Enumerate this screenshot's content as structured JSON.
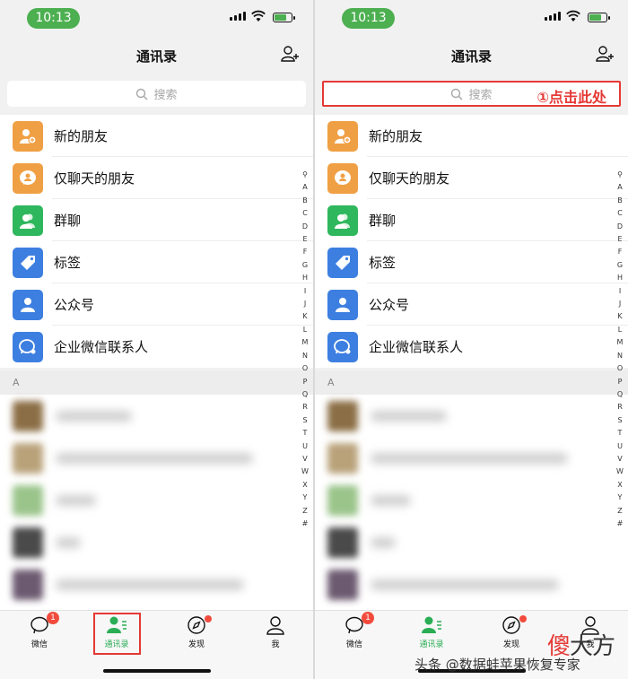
{
  "status_bar": {
    "time": "10:13"
  },
  "nav": {
    "title": "通讯录"
  },
  "search": {
    "placeholder": "搜索",
    "annotation": "①点击此处"
  },
  "menu_items": [
    {
      "label": "新的朋友",
      "icon": "new-friend-icon",
      "color": "#f0a044"
    },
    {
      "label": "仅聊天的朋友",
      "icon": "chat-only-friend-icon",
      "color": "#f0a044"
    },
    {
      "label": "群聊",
      "icon": "group-chat-icon",
      "color": "#2fb75e"
    },
    {
      "label": "标签",
      "icon": "tag-icon",
      "color": "#3d7fe0"
    },
    {
      "label": "公众号",
      "icon": "official-account-icon",
      "color": "#3d7fe0"
    },
    {
      "label": "企业微信联系人",
      "icon": "wecom-contact-icon",
      "color": "#3d7fe0"
    }
  ],
  "section": {
    "letter": "A"
  },
  "index_letters": [
    "Q",
    "A",
    "B",
    "C",
    "D",
    "E",
    "F",
    "G",
    "H",
    "I",
    "J",
    "K",
    "L",
    "M",
    "N",
    "O",
    "P",
    "Q",
    "R",
    "S",
    "T",
    "U",
    "V",
    "W",
    "X",
    "Y",
    "Z",
    "#"
  ],
  "tabs": [
    {
      "label": "微信",
      "icon": "chat-bubble-icon",
      "badge": "1"
    },
    {
      "label": "通讯录",
      "icon": "contacts-icon",
      "active": true
    },
    {
      "label": "发现",
      "icon": "compass-icon",
      "dot": true
    },
    {
      "label": "我",
      "icon": "person-icon"
    }
  ],
  "watermark": {
    "text": "头条 @数据蛙苹果恢复专家",
    "logo_char1": "傻",
    "logo_char2": "大方"
  },
  "colors": {
    "accent_green": "#2bad55",
    "highlight_red": "#e53935",
    "badge_red": "#f24b3d"
  }
}
